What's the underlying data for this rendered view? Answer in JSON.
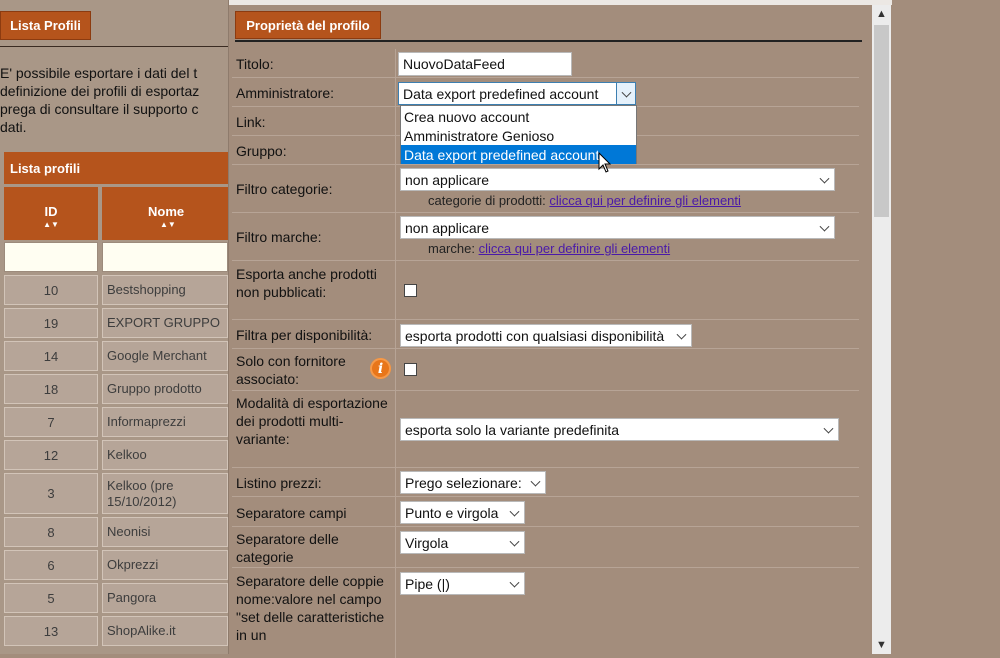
{
  "left": {
    "lista_profili_button": "Lista Profili",
    "intro_lines": [
      "E' possibile esportare i dati del t",
      "definizione dei profili di esportaz",
      "prega di consultare il supporto c",
      "dati."
    ],
    "table_title": "Lista profili",
    "columns": [
      "ID",
      "Nome"
    ],
    "sort_glyph": "▲▼",
    "rows": [
      {
        "id": "10",
        "name": "Bestshopping"
      },
      {
        "id": "19",
        "name": "EXPORT GRUPPO"
      },
      {
        "id": "14",
        "name": "Google Merchant"
      },
      {
        "id": "18",
        "name": "Gruppo prodotto"
      },
      {
        "id": "7",
        "name": "Informaprezzi"
      },
      {
        "id": "12",
        "name": "Kelkoo"
      },
      {
        "id": "3",
        "name": "Kelkoo (pre 15/10/2012)"
      },
      {
        "id": "8",
        "name": "Neonisi"
      },
      {
        "id": "6",
        "name": "Okprezzi"
      },
      {
        "id": "5",
        "name": "Pangora"
      },
      {
        "id": "13",
        "name": "ShopAlike.it"
      }
    ]
  },
  "dialog": {
    "title": "Proprietà del profilo",
    "fields": {
      "titolo_label": "Titolo:",
      "titolo_value": "NuovoDataFeed",
      "amministratore_label": "Amministratore:",
      "amministratore_value": "Data export predefined account",
      "link_label": "Link:",
      "gruppo_label": "Gruppo:",
      "filtro_categorie_label": "Filtro categorie:",
      "filtro_categorie_value": "non applicare",
      "categorie_sub_label": "categorie di prodotti:",
      "categorie_sub_link": "clicca qui per definire gli elementi",
      "filtro_marche_label": "Filtro marche:",
      "filtro_marche_value": "non applicare",
      "marche_sub_label": "marche:",
      "marche_sub_link": "clicca qui per definire gli elementi",
      "esporta_label": "Esporta anche prodotti non pubblicati:",
      "filtra_label": "Filtra per disponibilità:",
      "filtra_value": "esporta prodotti con qualsiasi disponibilità",
      "fornitore_label": "Solo con fornitore associato:",
      "info_glyph": "i",
      "modalita_label": "Modalità di esportazione dei prodotti multi-variante:",
      "modalita_value": "esporta solo la variante predefinita",
      "listino_label": "Listino prezzi:",
      "listino_value": "Prego selezionare:",
      "sep_campi_label": "Separatore campi",
      "sep_campi_value": "Punto e virgola",
      "sep_categorie_label": "Separatore delle categorie",
      "sep_categorie_value": "Virgola",
      "sep_coppie_label": "Separatore delle coppie nome:valore nel campo \"set delle caratteristiche in un",
      "sep_coppie_value": "Pipe (|)"
    },
    "dropdown_options": [
      "Crea nuovo account",
      "Amministratore Genioso",
      "Data export predefined account"
    ],
    "dropdown_selected": "Data export predefined account"
  },
  "scrollbar": {
    "up": "▲",
    "down": "▼"
  }
}
